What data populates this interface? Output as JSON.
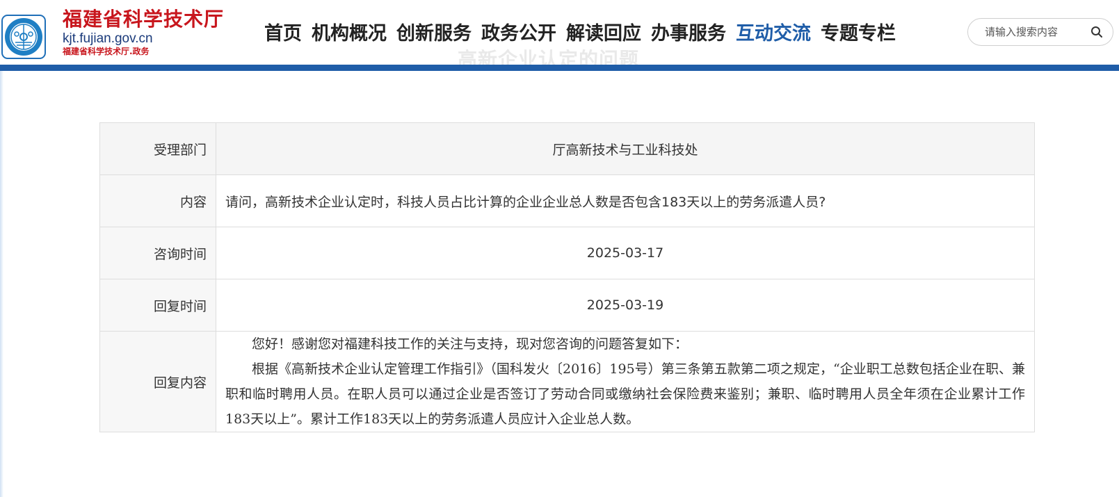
{
  "header": {
    "brand_title": "福建省科学技术厅",
    "brand_domain": "kjt.fujian.gov.cn",
    "brand_sub": "福建省科学技术厅.政务",
    "emblem_icon": "fujian-sci-tech-emblem-icon",
    "nav": [
      {
        "label": "首页"
      },
      {
        "label": "机构概况"
      },
      {
        "label": "创新服务"
      },
      {
        "label": "政务公开"
      },
      {
        "label": "解读回应"
      },
      {
        "label": "办事服务"
      },
      {
        "label": "互动交流",
        "active": true
      },
      {
        "label": "专题专栏"
      }
    ],
    "search": {
      "placeholder": "请输入搜索内容",
      "icon": "search-icon"
    },
    "ghost_title": "高新企业认定的问题"
  },
  "colors": {
    "brand_red": "#c8161d",
    "accent_blue": "#1f5da8",
    "border": "#dddddd"
  },
  "table": {
    "department": {
      "label": "受理部门",
      "value": "厅高新技术与工业科技处"
    },
    "content": {
      "label": "内容",
      "value": "请问，高新技术企业认定时，科技人员占比计算的企业企业总人数是否包含183天以上的劳务派遣人员?"
    },
    "consult_time": {
      "label": "咨询时间",
      "value": "2025-03-17"
    },
    "reply_time": {
      "label": "回复时间",
      "value": "2025-03-19"
    },
    "reply_content": {
      "label": "回复内容",
      "paragraphs": [
        "您好！感谢您对福建科技工作的关注与支持，现对您咨询的问题答复如下：",
        "根据《高新技术企业认定管理工作指引》（国科发火〔2016〕195号）第三条第五款第二项之规定，“企业职工总数包括企业在职、兼职和临时聘用人员。在职人员可以通过企业是否签订了劳动合同或缴纳社会保险费来鉴别；兼职、临时聘用人员全年须在企业累计工作183天以上”。累计工作183天以上的劳务派遣人员应计入企业总人数。"
      ]
    }
  }
}
